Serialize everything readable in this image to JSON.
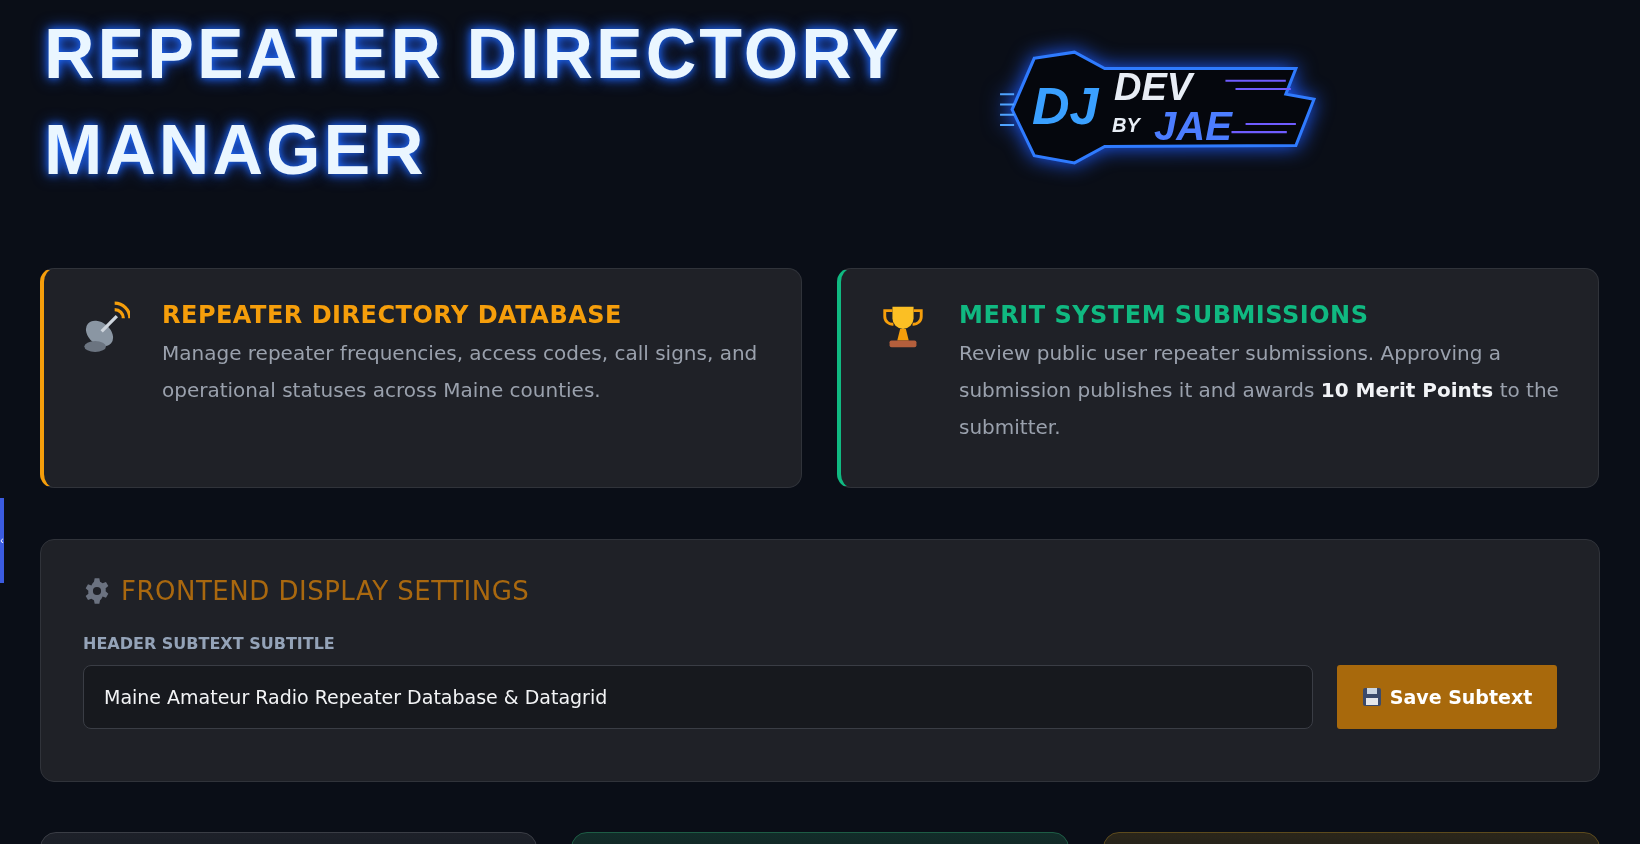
{
  "header": {
    "title_lines": [
      "REPEATER DIRECTORY",
      "MANAGER"
    ],
    "logo": {
      "monogram": "DJ",
      "top": "DEV",
      "small": "BY",
      "bottom": "JAE"
    }
  },
  "side_toggle": {
    "glyph": "‹"
  },
  "info_cards": [
    {
      "kind": "dish",
      "title": "REPEATER DIRECTORY DATABASE",
      "color": "#f59e0b",
      "text": "Manage repeater frequencies, access codes, call signs, and operational statuses across Maine counties."
    },
    {
      "kind": "trophy",
      "title": "MERIT SYSTEM SUBMISSIONS",
      "color": "#10b981",
      "text": "Review public user repeater submissions. Approving a submission publishes it and awards **10 Merit Points** to the submitter."
    }
  ],
  "settings": {
    "title": "FRONTEND DISPLAY SETTINGS",
    "field_label": "HEADER SUBTEXT SUBTITLE",
    "value": "Maine Amateur Radio Repeater Database & Datagrid",
    "button": "Save Subtext"
  },
  "summary_cards": [
    {
      "color": "#3a3d45"
    },
    {
      "color": "#1d5c45"
    },
    {
      "color": "#5c4a1d"
    }
  ]
}
